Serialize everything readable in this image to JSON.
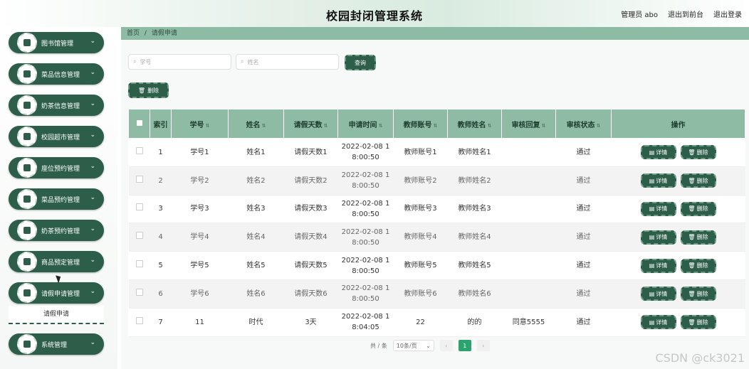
{
  "app_title": "校园封闭管理系统",
  "top_links": {
    "user": "管理员 abo",
    "back": "退出到前台",
    "logout": "退出登录"
  },
  "breadcrumb": {
    "home": "首页",
    "sep": "/",
    "current": "请假申请"
  },
  "sidebar": {
    "items": [
      {
        "label": "图书馆管理"
      },
      {
        "label": "菜品信息管理"
      },
      {
        "label": "奶茶信息管理"
      },
      {
        "label": "校园超市管理"
      },
      {
        "label": "座位预约管理"
      },
      {
        "label": "菜品预约管理"
      },
      {
        "label": "奶茶预约管理"
      },
      {
        "label": "商品预定管理"
      },
      {
        "label": "请假申请管理"
      },
      {
        "label": "系统管理"
      }
    ],
    "submenu_label": "请假申请",
    "chevron": "⌄"
  },
  "search": {
    "xuehao_placeholder": "学号",
    "xingming_placeholder": "姓名",
    "query_button": "查询"
  },
  "toolbar": {
    "delete_label": "删除"
  },
  "table": {
    "headers": [
      "索引",
      "学号",
      "姓名",
      "请假天数",
      "申请时间",
      "教师账号",
      "教师姓名",
      "审核回复",
      "审核状态",
      "操作"
    ],
    "rows": [
      {
        "idx": "1",
        "xuehao": "学号1",
        "xingming": "姓名1",
        "days": "请假天数1",
        "time1": "2022-02-08 1",
        "time2": "8:00:50",
        "tacct": "教师账号1",
        "tname": "教师姓名1",
        "reply": "",
        "status": "通过"
      },
      {
        "idx": "2",
        "xuehao": "学号2",
        "xingming": "姓名2",
        "days": "请假天数2",
        "time1": "2022-02-08 1",
        "time2": "8:00:50",
        "tacct": "教师账号2",
        "tname": "教师姓名2",
        "reply": "",
        "status": "通过"
      },
      {
        "idx": "3",
        "xuehao": "学号3",
        "xingming": "姓名3",
        "days": "请假天数3",
        "time1": "2022-02-08 1",
        "time2": "8:00:50",
        "tacct": "教师账号3",
        "tname": "教师姓名3",
        "reply": "",
        "status": "通过"
      },
      {
        "idx": "4",
        "xuehao": "学号4",
        "xingming": "姓名4",
        "days": "请假天数4",
        "time1": "2022-02-08 1",
        "time2": "8:00:50",
        "tacct": "教师账号4",
        "tname": "教师姓名4",
        "reply": "",
        "status": "通过"
      },
      {
        "idx": "5",
        "xuehao": "学号5",
        "xingming": "姓名5",
        "days": "请假天数5",
        "time1": "2022-02-08 1",
        "time2": "8:00:50",
        "tacct": "教师账号5",
        "tname": "教师姓名5",
        "reply": "",
        "status": "通过"
      },
      {
        "idx": "6",
        "xuehao": "学号6",
        "xingming": "姓名6",
        "days": "请假天数6",
        "time1": "2022-02-08 1",
        "time2": "8:00:50",
        "tacct": "教师账号6",
        "tname": "教师姓名6",
        "reply": "",
        "status": "通过"
      },
      {
        "idx": "7",
        "xuehao": "11",
        "xingming": "时代",
        "days": "3天",
        "time1": "2022-02-08 1",
        "time2": "8:04:05",
        "tacct": "22",
        "tname": "的的",
        "reply": "同意5555",
        "status": "通过"
      }
    ],
    "detail_label": "详情",
    "delete_label": "删除"
  },
  "pagination": {
    "total_text": "共 / 条",
    "page_size": "10条/页",
    "current_page": "1",
    "prev": "‹",
    "next": "›"
  },
  "watermark": "CSDN @ck3021",
  "colors": {
    "primary": "#2c5e4a",
    "header_bg": "#8dbba4",
    "page_active": "#2ba36d"
  }
}
